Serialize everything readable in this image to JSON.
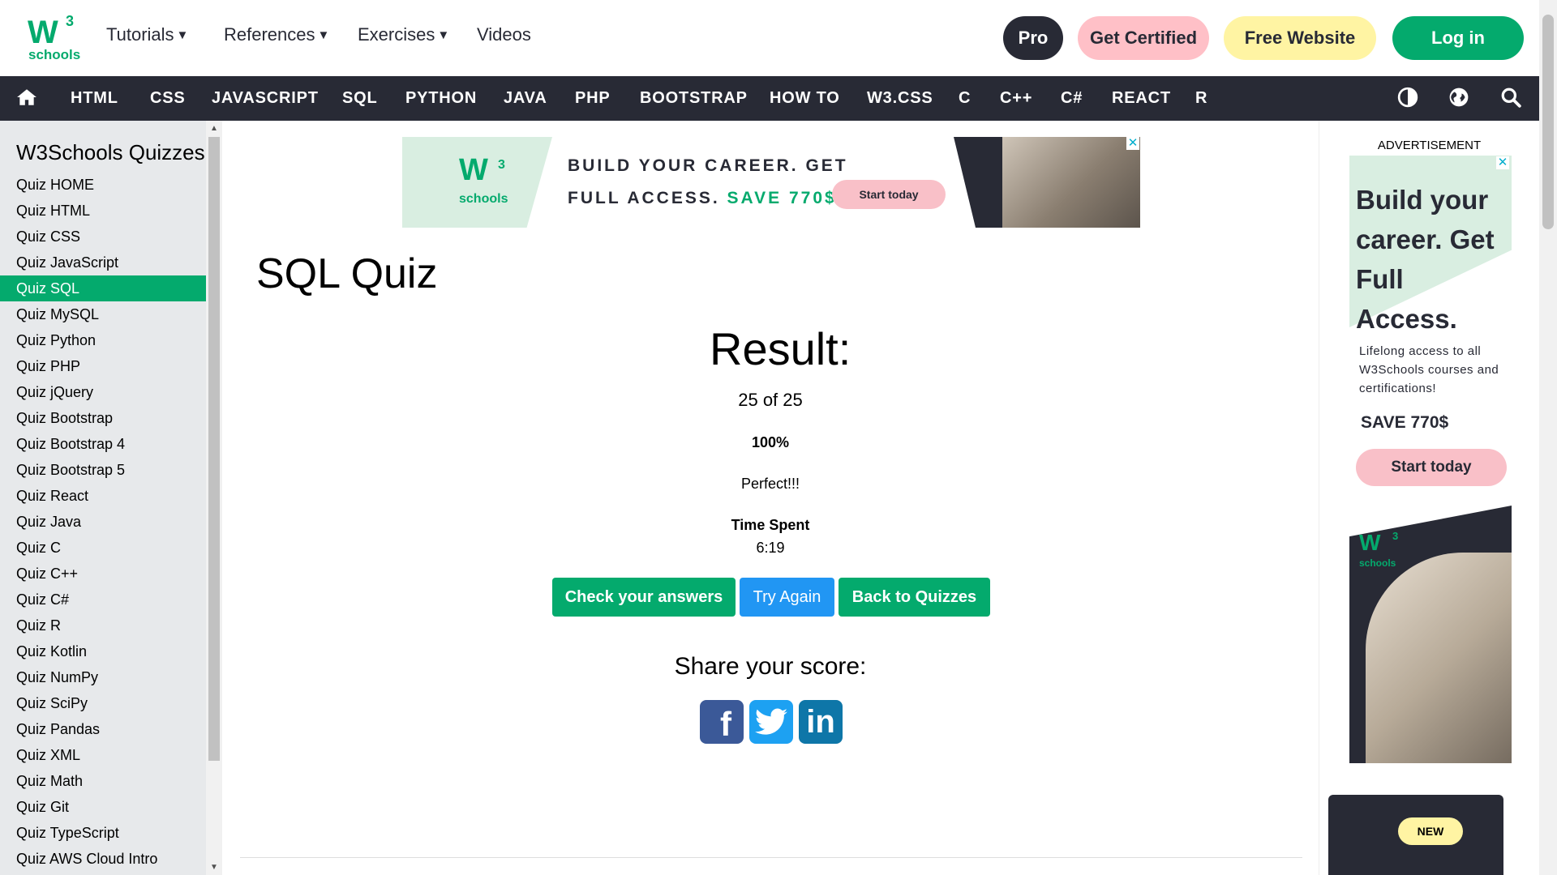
{
  "logo": {
    "mark": "W",
    "sup": "3",
    "text": "schools"
  },
  "header": {
    "nav": [
      {
        "label": "Tutorials",
        "caret": "▼"
      },
      {
        "label": "References",
        "caret": "▼"
      },
      {
        "label": "Exercises",
        "caret": "▼"
      },
      {
        "label": "Videos"
      }
    ],
    "buttons": {
      "pro": "Pro",
      "certified": "Get Certified",
      "free_website": "Free Website",
      "login": "Log in"
    }
  },
  "navbar": {
    "items": [
      "HTML",
      "CSS",
      "JAVASCRIPT",
      "SQL",
      "PYTHON",
      "JAVA",
      "PHP",
      "BOOTSTRAP",
      "HOW TO",
      "W3.CSS",
      "C",
      "C++",
      "C#",
      "REACT",
      "R"
    ]
  },
  "sidebar": {
    "title": "W3Schools Quizzes",
    "items": [
      "Quiz HOME",
      "Quiz HTML",
      "Quiz CSS",
      "Quiz JavaScript",
      "Quiz SQL",
      "Quiz MySQL",
      "Quiz Python",
      "Quiz PHP",
      "Quiz jQuery",
      "Quiz Bootstrap",
      "Quiz Bootstrap 4",
      "Quiz Bootstrap 5",
      "Quiz React",
      "Quiz Java",
      "Quiz C",
      "Quiz C++",
      "Quiz C#",
      "Quiz R",
      "Quiz Kotlin",
      "Quiz NumPy",
      "Quiz SciPy",
      "Quiz Pandas",
      "Quiz XML",
      "Quiz Math",
      "Quiz Git",
      "Quiz TypeScript",
      "Quiz AWS Cloud Intro"
    ],
    "active": "Quiz SQL"
  },
  "banner_ad": {
    "line1": "BUILD YOUR CAREER. GET",
    "line2": "FULL ACCESS.",
    "line2_highlight": "SAVE 770$",
    "cta": "Start today",
    "close": "✕"
  },
  "main": {
    "title": "SQL Quiz",
    "result_heading": "Result:",
    "score": "25 of 25",
    "percent": "100%",
    "message": "Perfect!!!",
    "time_label": "Time Spent",
    "time_value": "6:19",
    "buttons": {
      "check": "Check your answers",
      "try_again": "Try Again",
      "back": "Back to Quizzes"
    },
    "share_heading": "Share your score:",
    "social": [
      "f",
      "t",
      "in"
    ]
  },
  "side_ad": {
    "label": "ADVERTISEMENT",
    "headline": "Build your career. Get Full Access.",
    "body": "Lifelong access to all W3Schools courses and certifications!",
    "save": "SAVE 770$",
    "cta": "Start today",
    "close": "✕"
  },
  "new_promo": {
    "badge": "NEW"
  },
  "colors": {
    "brand_green": "#04AA6D",
    "nav_dark": "#282A35",
    "blue_button": "#2196F3",
    "pink": "#FFC0C7",
    "yellow": "#FFF4A3"
  }
}
